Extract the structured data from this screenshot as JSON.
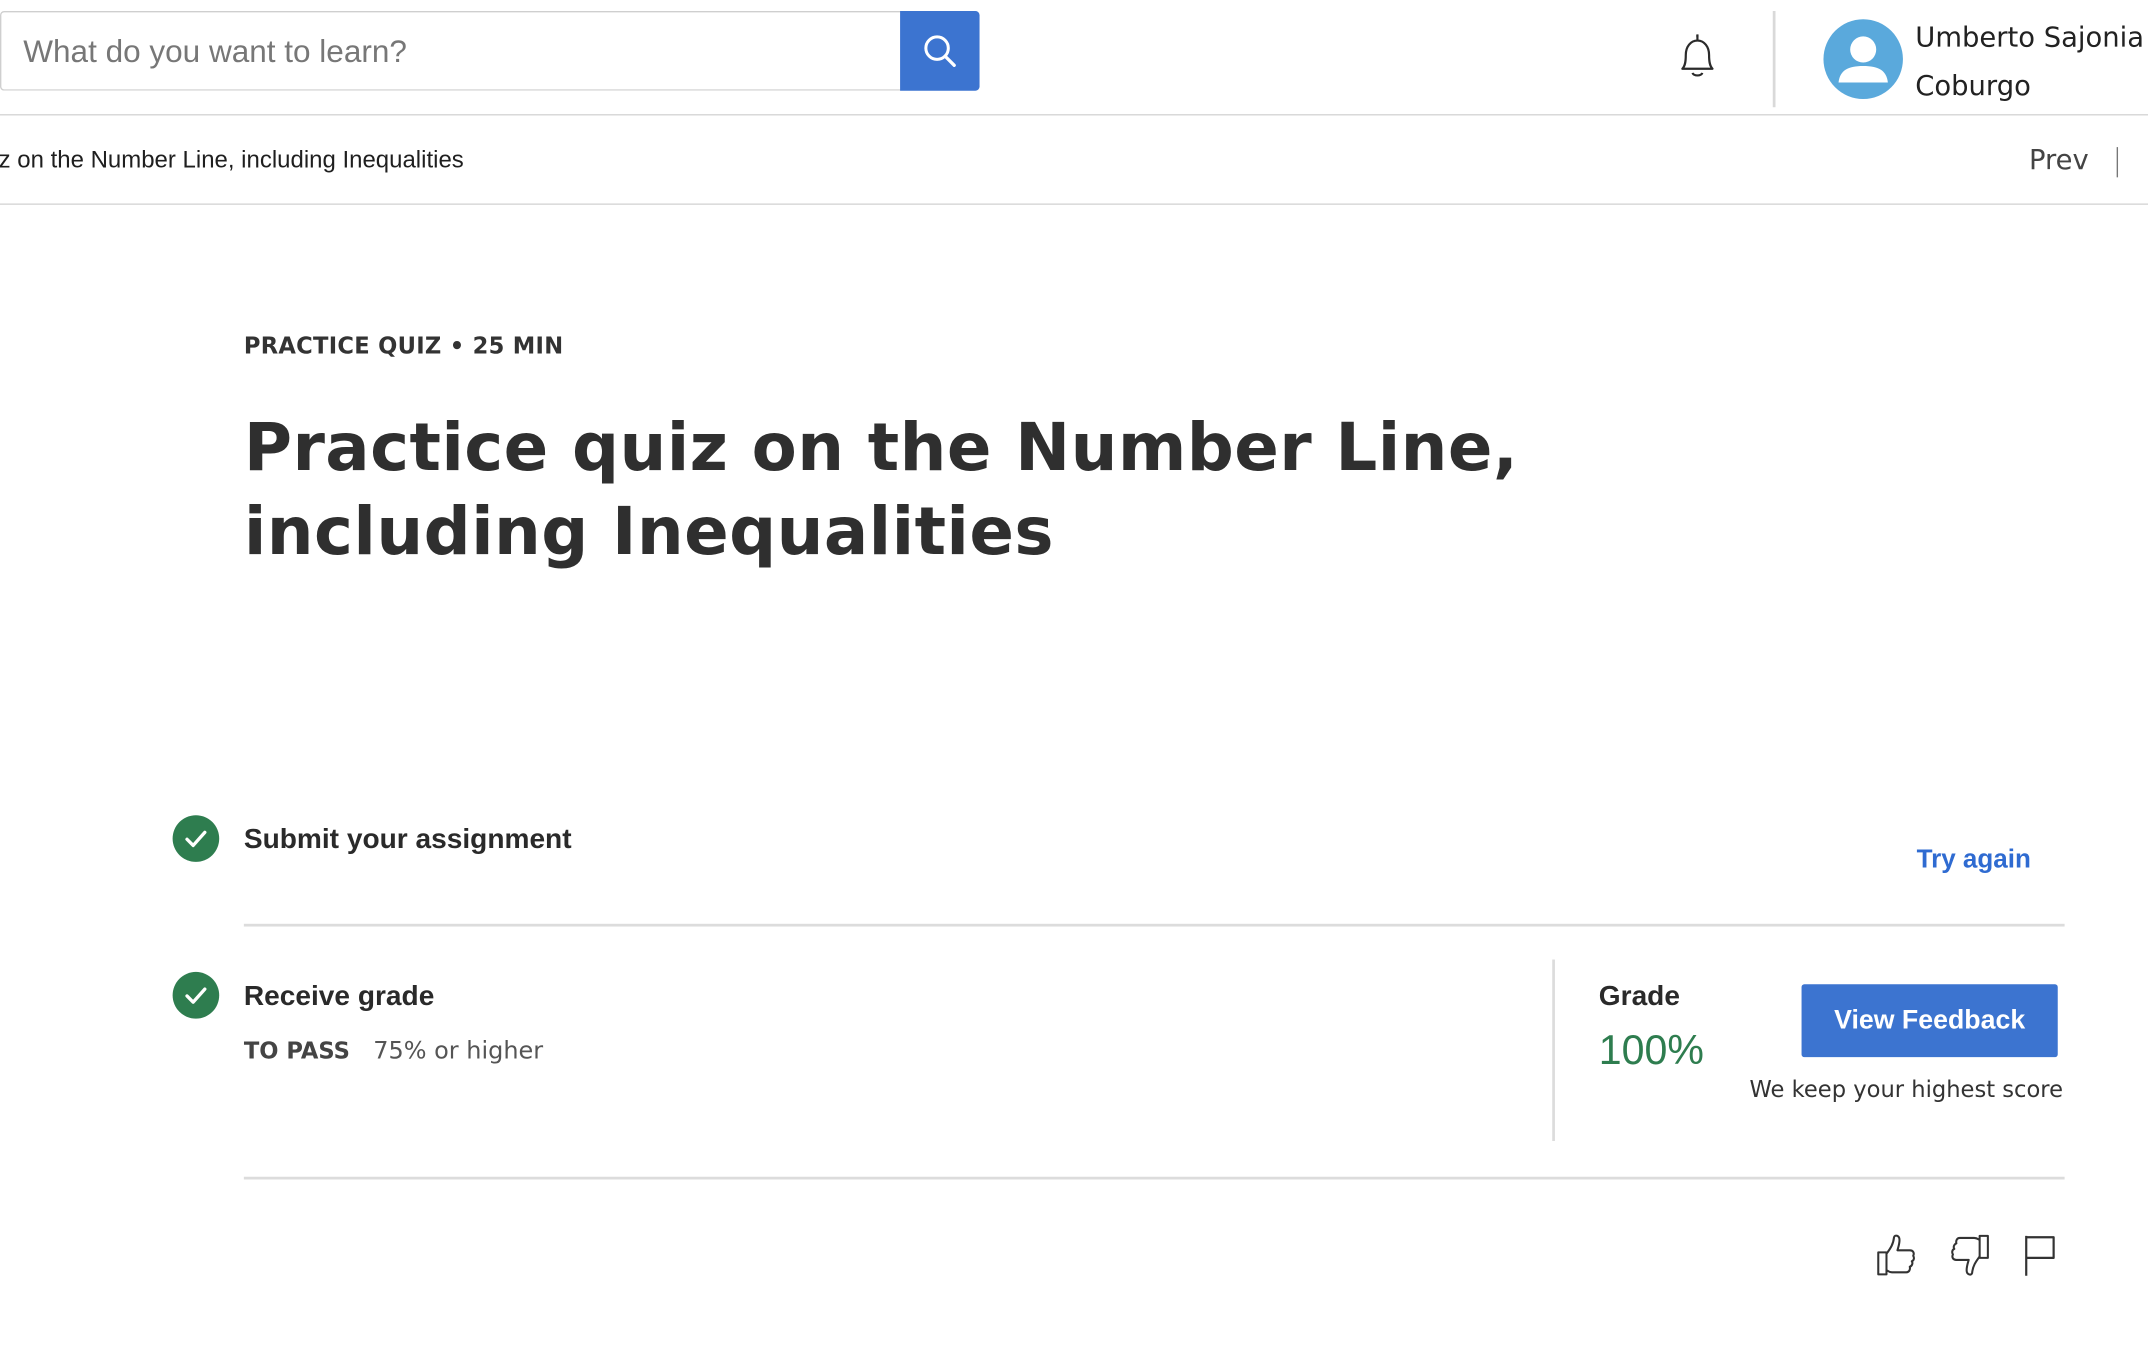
{
  "header": {
    "search": {
      "placeholder": "What do you want to learn?",
      "button_icon": "search-icon"
    },
    "notifications_icon": "bell-icon",
    "user": {
      "avatar_icon": "user-avatar-icon",
      "first_line": "Umberto Sajonia",
      "second_line": "Coburgo"
    }
  },
  "breadcrumb": {
    "title": "z on the Number Line, including Inequalities",
    "prev_label": "Prev"
  },
  "quiz": {
    "eyebrow": "PRACTICE QUIZ • 25 MIN",
    "title": "Practice quiz on the Number Line, including Inequalities"
  },
  "steps": {
    "submit": {
      "label": "Submit your assignment",
      "action": "Try again",
      "completed": true
    },
    "grade": {
      "label": "Receive grade",
      "pass_key": "TO PASS",
      "pass_value": "75% or higher",
      "completed": true
    }
  },
  "result": {
    "grade_label": "Grade",
    "grade_value": "100%",
    "feedback_button": "View Feedback",
    "note": "We keep your highest score"
  },
  "reactions": {
    "like_icon": "thumbs-up-icon",
    "dislike_icon": "thumbs-down-icon",
    "report_icon": "flag-icon"
  },
  "colors": {
    "primary": "#3c74d0",
    "success": "#2e7d4f",
    "link": "#2f6bd1",
    "avatar": "#5aa9dc",
    "divider": "#dcdcdc"
  }
}
